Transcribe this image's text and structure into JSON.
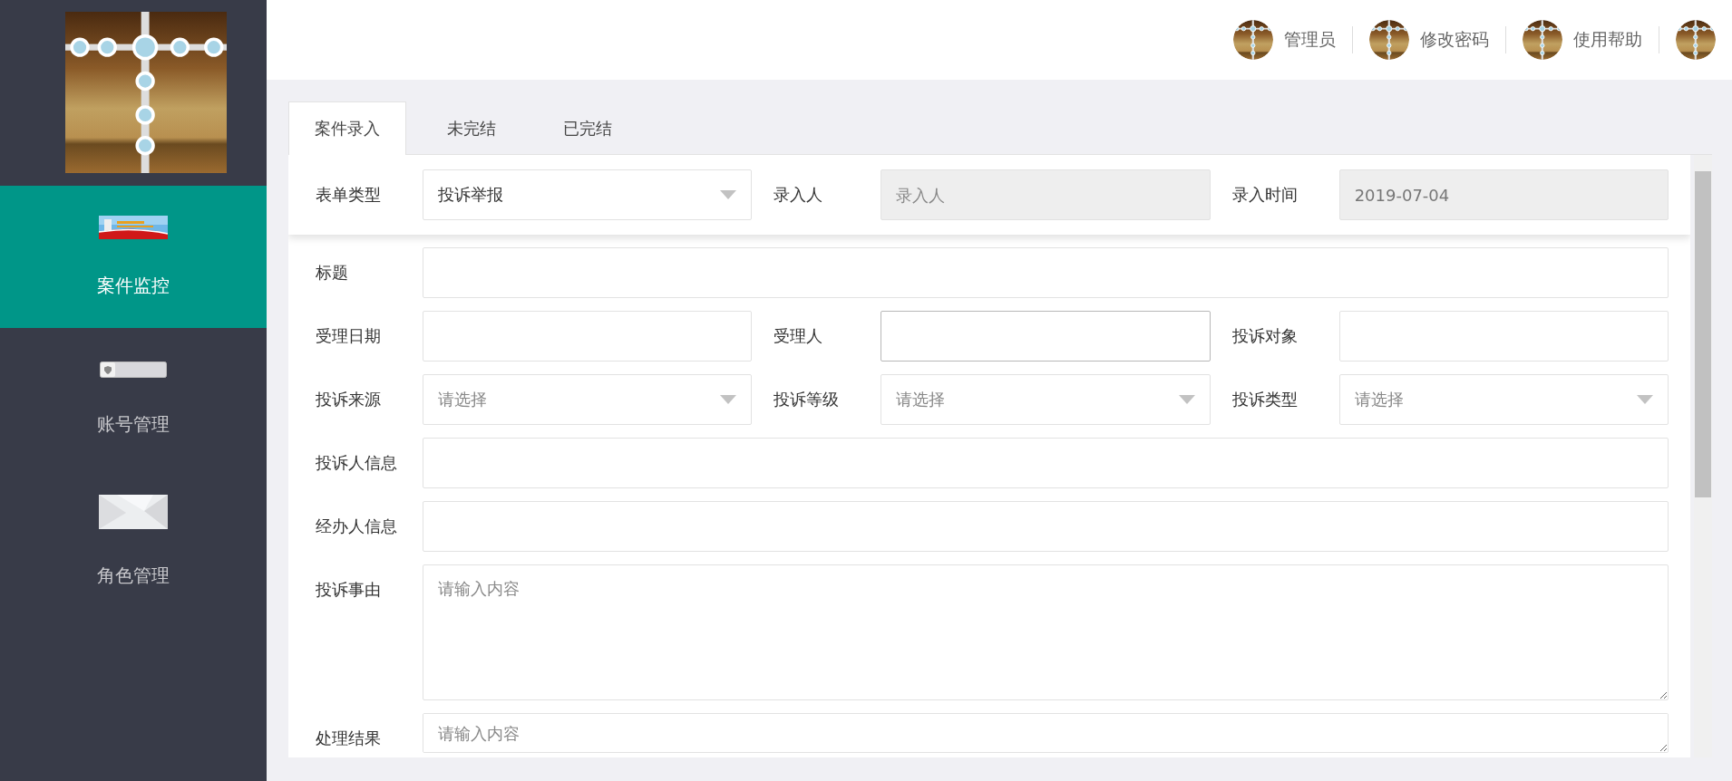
{
  "sidebar": {
    "items": [
      {
        "label": "案件监控",
        "selected": true,
        "kind": "banner"
      },
      {
        "label": "账号管理",
        "selected": false,
        "kind": "toggle"
      },
      {
        "label": "角色管理",
        "selected": false,
        "kind": "paper"
      }
    ]
  },
  "header": {
    "items": [
      {
        "kind": "link",
        "label": "管理员"
      },
      {
        "kind": "link",
        "label": "修改密码"
      },
      {
        "kind": "link",
        "label": "使用帮助"
      },
      {
        "kind": "avatar"
      }
    ]
  },
  "tabs": [
    {
      "label": "案件录入",
      "selected": true
    },
    {
      "label": "未完结",
      "selected": false
    },
    {
      "label": "已完结",
      "selected": false
    }
  ],
  "form": {
    "top_row": [
      {
        "label": "表单类型",
        "field": {
          "kind": "select",
          "value": "投诉举报",
          "disabled": false
        }
      },
      {
        "label": "录入人",
        "field": {
          "kind": "input",
          "placeholder": "录入人",
          "disabled": true
        }
      },
      {
        "label": "录入时间",
        "field": {
          "kind": "input",
          "value": "2019-07-04",
          "disabled": true
        }
      }
    ],
    "rows": [
      [
        {
          "label": "标题",
          "field": {
            "kind": "input",
            "focused": false
          }
        }
      ],
      [
        {
          "label": "受理日期",
          "field": {
            "kind": "input",
            "focused": false
          }
        },
        {
          "label": "受理人",
          "field": {
            "kind": "input",
            "focused": true
          }
        },
        {
          "label": "投诉对象",
          "field": {
            "kind": "input",
            "focused": false
          }
        }
      ],
      [
        {
          "label": "投诉来源",
          "field": {
            "kind": "select",
            "placeholder": "请选择",
            "focused": false
          }
        },
        {
          "label": "投诉等级",
          "field": {
            "kind": "select",
            "placeholder": "请选择",
            "focused": false
          }
        },
        {
          "label": "投诉类型",
          "field": {
            "kind": "select",
            "placeholder": "请选择",
            "focused": false
          }
        }
      ],
      [
        {
          "label": "投诉人信息",
          "field": {
            "kind": "input",
            "focused": false
          }
        }
      ],
      [
        {
          "label": "经办人信息",
          "field": {
            "kind": "input",
            "focused": false
          }
        }
      ],
      [
        {
          "label": "投诉事由",
          "field": {
            "kind": "textarea",
            "placeholder": "请输入内容",
            "focused": false
          }
        }
      ],
      [
        {
          "label": "处理结果",
          "field": {
            "kind": "textarea-short",
            "placeholder": "请输入内容",
            "focused": false
          }
        }
      ]
    ]
  }
}
